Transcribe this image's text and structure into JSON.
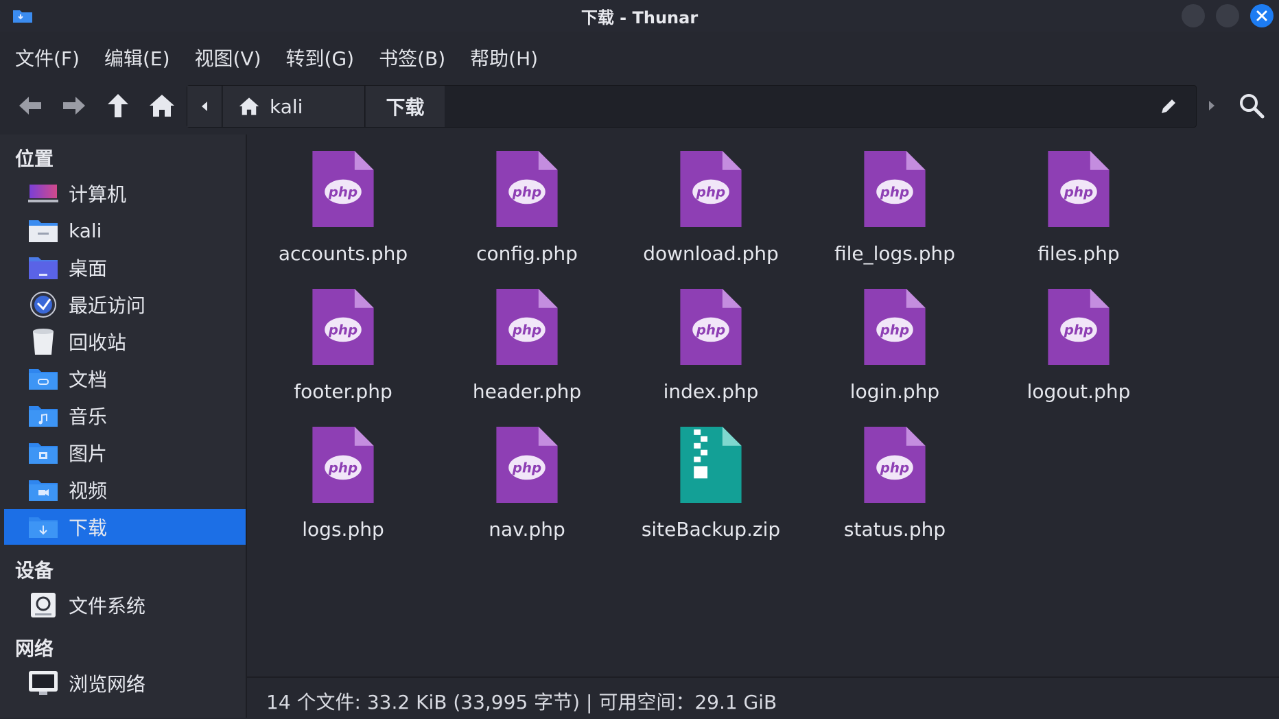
{
  "window": {
    "title": "下载 - Thunar"
  },
  "menu": [
    "文件(F)",
    "编辑(E)",
    "视图(V)",
    "转到(G)",
    "书签(B)",
    "帮助(H)"
  ],
  "path": {
    "home": "kali",
    "current": "下载"
  },
  "sidebar": {
    "sections": [
      {
        "title": "位置",
        "items": [
          {
            "label": "计算机",
            "icon": "computer-icon"
          },
          {
            "label": "kali",
            "icon": "home-folder-icon"
          },
          {
            "label": "桌面",
            "icon": "desktop-folder-icon"
          },
          {
            "label": "最近访问",
            "icon": "recent-icon"
          },
          {
            "label": "回收站",
            "icon": "trash-icon"
          },
          {
            "label": "文档",
            "icon": "documents-folder-icon"
          },
          {
            "label": "音乐",
            "icon": "music-folder-icon"
          },
          {
            "label": "图片",
            "icon": "pictures-folder-icon"
          },
          {
            "label": "视频",
            "icon": "videos-folder-icon"
          },
          {
            "label": "下载",
            "icon": "downloads-folder-icon",
            "active": true
          }
        ]
      },
      {
        "title": "设备",
        "items": [
          {
            "label": "文件系统",
            "icon": "drive-icon"
          }
        ]
      },
      {
        "title": "网络",
        "items": [
          {
            "label": "浏览网络",
            "icon": "network-icon"
          }
        ]
      }
    ]
  },
  "files": [
    {
      "name": "accounts.php",
      "type": "php"
    },
    {
      "name": "config.php",
      "type": "php"
    },
    {
      "name": "download.php",
      "type": "php"
    },
    {
      "name": "file_logs.php",
      "type": "php"
    },
    {
      "name": "files.php",
      "type": "php"
    },
    {
      "name": "footer.php",
      "type": "php"
    },
    {
      "name": "header.php",
      "type": "php"
    },
    {
      "name": "index.php",
      "type": "php"
    },
    {
      "name": "login.php",
      "type": "php"
    },
    {
      "name": "logout.php",
      "type": "php"
    },
    {
      "name": "logs.php",
      "type": "php"
    },
    {
      "name": "nav.php",
      "type": "php"
    },
    {
      "name": "siteBackup.zip",
      "type": "zip"
    },
    {
      "name": "status.php",
      "type": "php"
    }
  ],
  "php_icon_text": "php",
  "status": "14 个文件: 33.2 KiB (33,995 字节) | 可用空间：29.1 GiB",
  "colors": {
    "accent": "#1c6fe6",
    "php": "#8e3fb4",
    "zip": "#13a096",
    "close": "#1d7cf2"
  }
}
